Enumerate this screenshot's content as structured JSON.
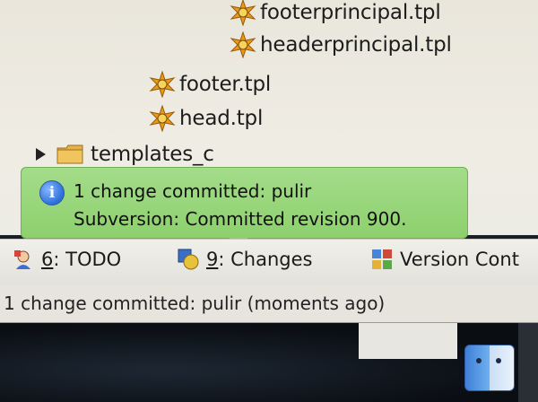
{
  "tree": {
    "items": [
      {
        "label": "footerprincipal.tpl",
        "icon": "tpl-file-icon"
      },
      {
        "label": "headerprincipal.tpl",
        "icon": "tpl-file-icon"
      },
      {
        "label": "footer.tpl",
        "icon": "tpl-file-icon"
      },
      {
        "label": "head.tpl",
        "icon": "tpl-file-icon"
      },
      {
        "label": "templates_c",
        "icon": "folder-icon"
      }
    ]
  },
  "notification": {
    "line1": "1 change committed: pulir",
    "line2": "Subversion: Committed revision 900.",
    "icon": "info-icon",
    "icon_glyph": "i",
    "color": "#8dd06d"
  },
  "toolbar": {
    "todo": {
      "mnemonic": "6",
      "rest": ": TODO"
    },
    "changes": {
      "mnemonic": "9",
      "rest": ": Changes"
    },
    "version_control": {
      "label": "Version Cont"
    }
  },
  "status": {
    "message": "1 change committed: pulir (moments ago)"
  }
}
